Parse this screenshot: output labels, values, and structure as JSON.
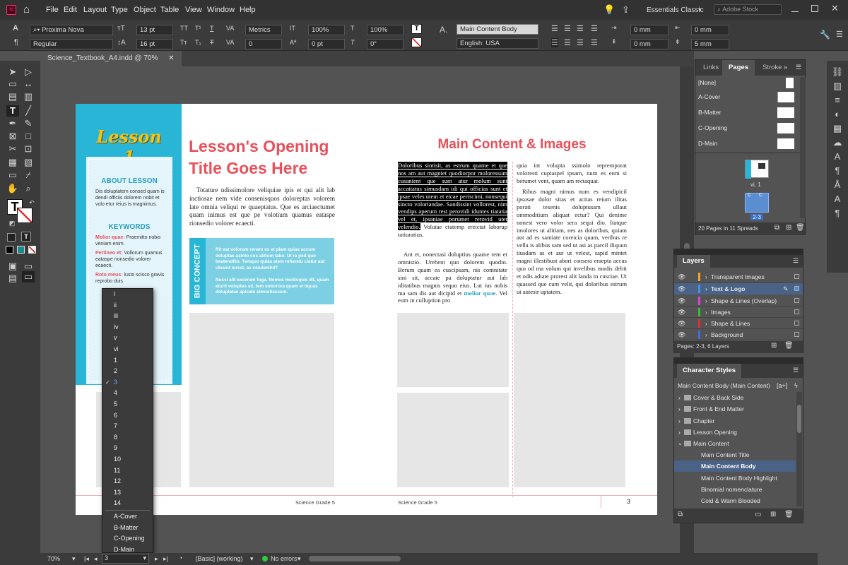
{
  "menu": {
    "items": [
      "File",
      "Edit",
      "Layout",
      "Type",
      "Object",
      "Table",
      "View",
      "Window",
      "Help"
    ],
    "workspace": "Essentials Classic",
    "search_placeholder": "Adobe Stock"
  },
  "control": {
    "font": "Proxima Nova",
    "style": "Regular",
    "size": "13 pt",
    "leading": "16 pt",
    "kerning": "Metrics",
    "tracking": "0",
    "hscale": "100%",
    "vscale": "100%",
    "baseline": "0 pt",
    "skew": "0°",
    "para_style": "Main Content Body",
    "language": "English: USA",
    "indent_left": "0 mm",
    "indent_right": "0 mm",
    "space_before": "0 mm",
    "space_after": "5 mm",
    "last_line": "0 mm",
    "bottom_field": "0 mm"
  },
  "document": {
    "tab": "Science_Textbook_A4.indd @ 70%"
  },
  "left_page": {
    "lesson": "Lesson 1",
    "about_heading": "ABOUT LESSON",
    "about_text": "Dis doluptatem consed quam is dendi officiis dolorem nobit et volo etur reius is magnimus.",
    "keywords_heading": "KEYWORDS",
    "keywords": [
      {
        "term": "Molior quae:",
        "text": "Praemitto nobis veniam enim."
      },
      {
        "term": "Pertineo et:",
        "text": "Vollorum quamus eataspe rionsedio volorer ecaecti."
      },
      {
        "term": "Roto meus:",
        "text": "lusto scisco gravis reprobo duis"
      }
    ],
    "title": "Lesson's Opening Title Goes Here",
    "intro": "Totature ndissimolore veliquiae ipis et qui alit lab inctiosae nem vide consenisquos doloreptas volorem late omnia veliqui re quaeptatus. Que es arciaectumet quam inimus est que pe volotium quamus eataspe rionsedio volorer ecaecti.",
    "big_concept_label": "BIG CONCEPT",
    "big_concept_p1": "Rit est volorum renem es et plam quias accum doluptae asinto cus alitium labo. Ut ra ped quo beatendillo. Temquo quias atem rehendu ciatur aut utasint iorest, as vendenihil?",
    "big_concept_p2": "Nossi alit excerum fuga. Nemos modisquis dit, quam eturit voluptas sit, tem solorrora quam et liquas doluptatae apicate simustiassum.",
    "footer": "Science Grade 5"
  },
  "right_page": {
    "title": "Main Content & Images",
    "col1_selected": "Doloribus sintisit, as estrum quame et que nos am aut magniet quodiorpor moloressum cusanient que sunt atur molum sunt accatiatus simusdam idi qui officias sunt et ipsae veles utem et eicae periscimi, nonsequi sincto voloriandae. Sandissint vollorest, nim vendips aperum rest perovidi iduntes tiatatia vel et, ipsaniae porumet rerovid utet velendio.",
    "col1_after": "Volutae ctatemp ereictat laborup tatiuratius.",
    "col1_p2": "Ant et, nonectasi doluptius quame rem et omnistio. Urehent quo dolorem quodio. Berum quam ea cuscipsam, nis comnitate sini sit, accate pa doluptatur aut lab iditatibus magnis sequo eius. Lut ius nobis ma sam dis aut dicipid et",
    "col1_link": "molior quae.",
    "col1_end": "Vel eum in culluption pro",
    "col2_p1": "quia int volupta ssimolo repremporat voloresti cuptaspel ipsam, num es eum si berumet vent, quam am rectaquat.",
    "col2_p2": "Ribus magni nimus num es vendipicil ipsusae dolor sitas et acitas reium ilitas porati tesenis doluptusam ullaut ommoditium aliquat ectur? Qui denime nonest vero volor sera sequi dio. Itatque imolores ut alitiam, nes as doloribus, quiam aut ad es santiate coreicia quam, veribus re vella is alibus sam sed ut asi as parcil iliquun tiusdam as et aut ut velest, sapid mintet magni illestibust abori consera eraepta accus quo od ma volum qui invelibus modis debit et odis adiate prorest alit landa in cusciae. Ut quassed que cum velit, qui doloribus estrum ut autestr uptatem.",
    "footer": "Science Grade 5",
    "page_number": "3"
  },
  "dropdown": {
    "items": [
      "i",
      "ii",
      "iii",
      "iv",
      "v",
      "vi",
      "1",
      "2",
      "3",
      "4",
      "5",
      "6",
      "7",
      "8",
      "9",
      "10",
      "11",
      "12",
      "13",
      "14",
      "A-Cover",
      "B-Matter",
      "C-Opening",
      "D-Main"
    ],
    "selected": "3"
  },
  "status": {
    "zoom": "70%",
    "page": "3",
    "style": "[Basic] (working)",
    "preflight": "No errors"
  },
  "pages_panel": {
    "tabs": [
      "Links",
      "Pages",
      "Stroke"
    ],
    "masters": [
      "[None]",
      "A-Cover",
      "B-Matter",
      "C-Opening",
      "D-Main"
    ],
    "spread1_label": "vi, 1",
    "spread2_label": "2-3",
    "footer": "20 Pages in 11 Spreads"
  },
  "layers_panel": {
    "title": "Layers",
    "layers": [
      {
        "name": "Transparent Images",
        "color": "#f5a623"
      },
      {
        "name": "Text & Logo",
        "color": "#4a90e2"
      },
      {
        "name": "Shape & Lines (Overlap)",
        "color": "#e040e0"
      },
      {
        "name": "Images",
        "color": "#30c030"
      },
      {
        "name": "Shape & Lines",
        "color": "#e03030"
      },
      {
        "name": "Background",
        "color": "#4070e0"
      }
    ],
    "footer": "Pages: 2-3, 6 Layers"
  },
  "char_styles_panel": {
    "title": "Character Styles",
    "current": "Main Content Body (Main Content)",
    "items": [
      {
        "name": "Cover & Back Side",
        "type": "folder"
      },
      {
        "name": "Front & End Matter",
        "type": "folder"
      },
      {
        "name": "Chapter",
        "type": "folder"
      },
      {
        "name": "Lesson Opening",
        "type": "folder"
      },
      {
        "name": "Main Content",
        "type": "folder-open"
      },
      {
        "name": "Main Content Title",
        "type": "style"
      },
      {
        "name": "Main Content Body",
        "type": "style",
        "selected": true
      },
      {
        "name": "Main Content Body Highlight",
        "type": "style"
      },
      {
        "name": "Binomial nomenclature",
        "type": "style"
      },
      {
        "name": "Cold & Warm Blooded",
        "type": "style"
      }
    ]
  },
  "colors": {
    "accent_red": "#e8505b",
    "cyan": "#29b6d6",
    "light_cyan": "#7dd0e3",
    "yellow": "#f2c318",
    "app_bg": "#535353"
  }
}
